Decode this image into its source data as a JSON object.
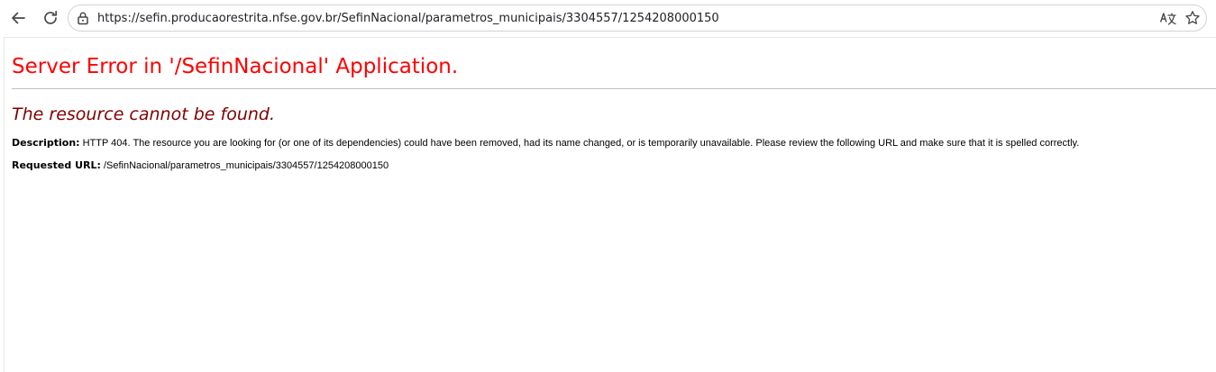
{
  "browser": {
    "address": "https://sefin.producaorestrita.nfse.gov.br/SefinNacional/parametros_municipais/3304557/1254208000150",
    "icons": {
      "back": "arrow-left-icon",
      "reload": "reload-icon",
      "security": "lock-icon",
      "translate": "translate-icon",
      "bookmark": "star-icon"
    }
  },
  "page": {
    "title": "Server Error in '/SefinNacional' Application.",
    "subtitle": "The resource cannot be found.",
    "description_label": "Description:",
    "description_text": " HTTP 404. The resource you are looking for (or one of its dependencies) could have been removed, had its name changed, or is temporarily unavailable.  Please review the following URL and make sure that it is spelled correctly.",
    "requested_url_label": "Requested URL:",
    "requested_url_value": " /SefinNacional/parametros_municipais/3304557/1254208000150",
    "colors": {
      "title": "#ff0000",
      "subtitle": "#800000",
      "divider": "#c0c0c0"
    }
  }
}
